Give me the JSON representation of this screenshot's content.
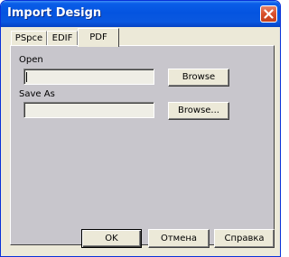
{
  "window": {
    "title": "Import Design"
  },
  "tabs": [
    {
      "label": "PSpce",
      "active": false
    },
    {
      "label": "EDIF",
      "active": false
    },
    {
      "label": "PDF",
      "active": true
    }
  ],
  "open": {
    "label": "Open",
    "value": "",
    "browse_label": "Browse"
  },
  "save_as": {
    "label": "Save As",
    "value": "",
    "browse_label": "Browse..."
  },
  "footer": {
    "ok_label": "OK",
    "cancel_label": "Отмена",
    "help_label": "Справка"
  },
  "colors": {
    "titlebar": "#0454e0",
    "close": "#d8502b",
    "panel": "#c8c6cc",
    "dialog": "#ece9d8"
  },
  "icons": {
    "close": "close-icon"
  }
}
